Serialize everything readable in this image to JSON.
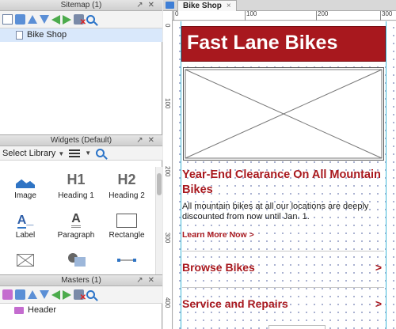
{
  "sitemap": {
    "title": "Sitemap (1)",
    "pages": [
      {
        "label": "Bike Shop"
      }
    ]
  },
  "widgets": {
    "title": "Widgets (Default)",
    "library_label": "Select Library",
    "items": [
      {
        "label": "Image",
        "icon": "image-icon"
      },
      {
        "label": "Heading 1",
        "glyph": "H1",
        "icon": "heading1-icon"
      },
      {
        "label": "Heading 2",
        "glyph": "H2",
        "icon": "heading2-icon"
      },
      {
        "label": "Label",
        "glyph": "A",
        "icon": "label-icon"
      },
      {
        "label": "Paragraph",
        "glyph": "A",
        "icon": "paragraph-icon"
      },
      {
        "label": "Rectangle",
        "icon": "rectangle-icon"
      }
    ]
  },
  "masters": {
    "title": "Masters (1)",
    "items": [
      {
        "label": "Header"
      }
    ]
  },
  "editor": {
    "tab_label": "Bike Shop",
    "tab_close": "×",
    "ruler_top": [
      "0",
      "100",
      "200",
      "300"
    ],
    "ruler_left": [
      "0",
      "100",
      "200",
      "300",
      "400"
    ]
  },
  "page": {
    "header_title": "Fast Lane Bikes",
    "promo_title": "Year-End Clearance On All Mountain Bikes",
    "promo_body": "All mountain bikes at all our locations are deeply discounted from now until Jan. 1.",
    "promo_link": "Learn More Now >",
    "nav": [
      {
        "label": "Browse Bikes",
        "arrow": ">"
      },
      {
        "label": "Service and Repairs",
        "arrow": ">"
      }
    ]
  },
  "colors": {
    "brand_red": "#a8181e",
    "selection_blue": "#d9e8fb",
    "guide_cyan": "#3fb8d8"
  }
}
